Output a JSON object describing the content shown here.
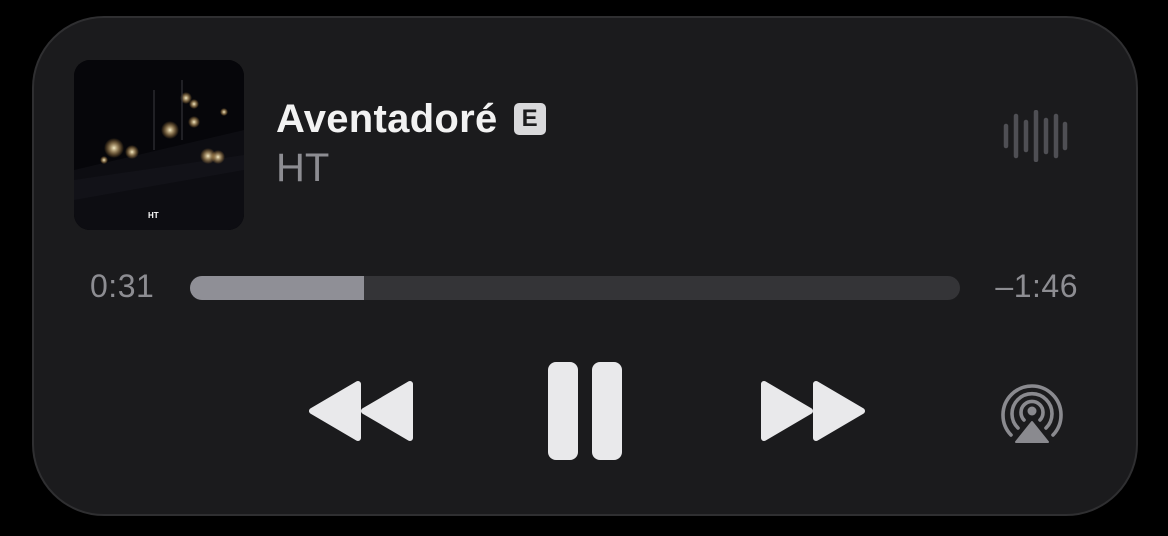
{
  "track": {
    "title": "Aventadoré",
    "explicit_label": "E",
    "artist": "HT"
  },
  "artwork": {
    "label": "HT"
  },
  "playback": {
    "elapsed": "0:31",
    "remaining": "–1:46",
    "progress_fraction": 0.226
  },
  "controls": {
    "rewind_icon": "rewind-icon",
    "pause_icon": "pause-icon",
    "forward_icon": "fast-forward-icon",
    "airplay_icon": "airplay-audio-icon",
    "waveform_icon": "waveform-icon"
  },
  "colors": {
    "background": "#1b1b1d",
    "primary_text": "#f2f2f2",
    "secondary_text": "#8d8d92",
    "progress_fill": "#8f8f96",
    "progress_track": "#343437",
    "control": "#e9e9eb"
  }
}
